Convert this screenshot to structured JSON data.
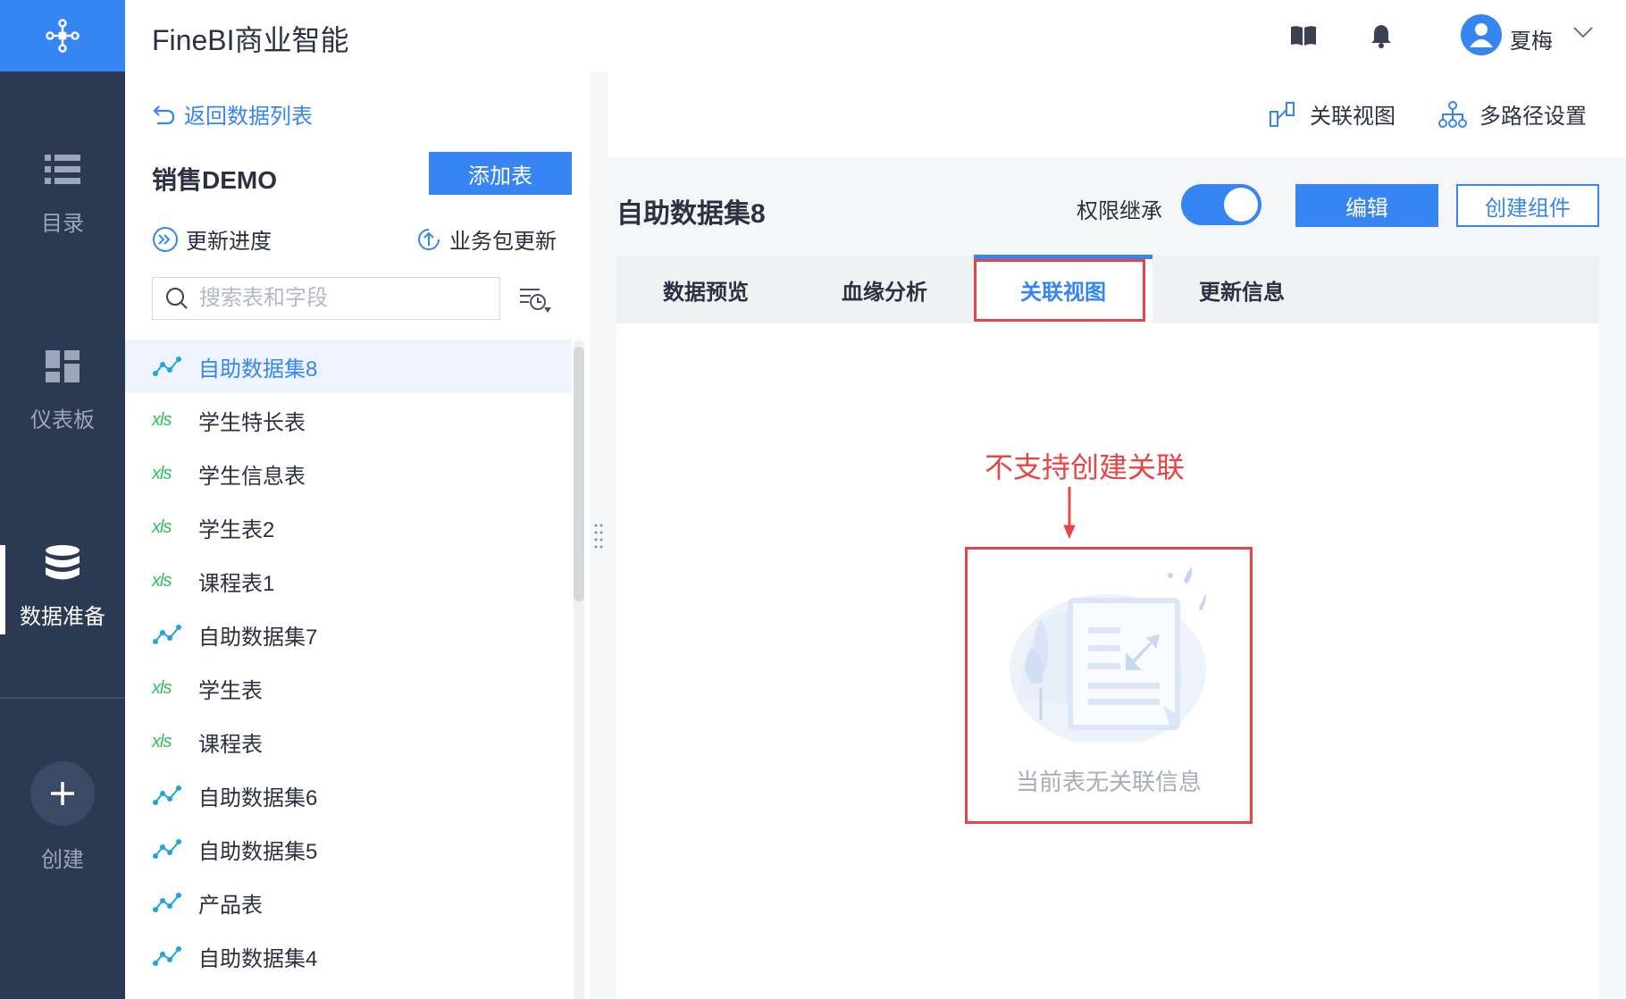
{
  "app": {
    "title": "FineBI商业智能"
  },
  "user": {
    "name": "夏梅"
  },
  "nav": {
    "items": [
      {
        "label": "目录",
        "icon": "list-icon"
      },
      {
        "label": "仪表板",
        "icon": "dashboard-icon"
      },
      {
        "label": "数据准备",
        "icon": "database-icon",
        "active": true
      },
      {
        "label": "创建",
        "icon": "plus-icon"
      }
    ]
  },
  "leftpanel": {
    "back_label": "返回数据列表",
    "package_title": "销售DEMO",
    "add_table_label": "添加表",
    "update_progress_label": "更新进度",
    "biz_update_label": "业务包更新",
    "search_placeholder": "搜索表和字段",
    "tables": [
      {
        "name": "自助数据集8",
        "type": "self-dataset",
        "active": true
      },
      {
        "name": "学生特长表",
        "type": "xls"
      },
      {
        "name": "学生信息表",
        "type": "xls"
      },
      {
        "name": "学生表2",
        "type": "xls"
      },
      {
        "name": "课程表1",
        "type": "xls"
      },
      {
        "name": "自助数据集7",
        "type": "self-dataset"
      },
      {
        "name": "学生表",
        "type": "xls"
      },
      {
        "name": "课程表",
        "type": "xls"
      },
      {
        "name": "自助数据集6",
        "type": "self-dataset"
      },
      {
        "name": "自助数据集5",
        "type": "self-dataset"
      },
      {
        "name": "产品表",
        "type": "self-dataset"
      },
      {
        "name": "自助数据集4",
        "type": "self-dataset"
      }
    ],
    "xls_text": "xls"
  },
  "toolbar": {
    "relation_view_label": "关联视图",
    "multipath_label": "多路径设置"
  },
  "dataset": {
    "title": "自助数据集8",
    "permission_label": "权限继承",
    "permission_on": true,
    "edit_label": "编辑",
    "create_component_label": "创建组件"
  },
  "tabs": [
    {
      "label": "数据预览"
    },
    {
      "label": "血缘分析"
    },
    {
      "label": "关联视图",
      "active": true
    },
    {
      "label": "更新信息"
    }
  ],
  "content": {
    "annotation": "不支持创建关联",
    "empty_text": "当前表无关联信息"
  },
  "colors": {
    "accent": "#3685f2",
    "nav_bg": "#2b3a52",
    "annotation_red": "#e84444",
    "xls_green": "#2ec05a"
  }
}
